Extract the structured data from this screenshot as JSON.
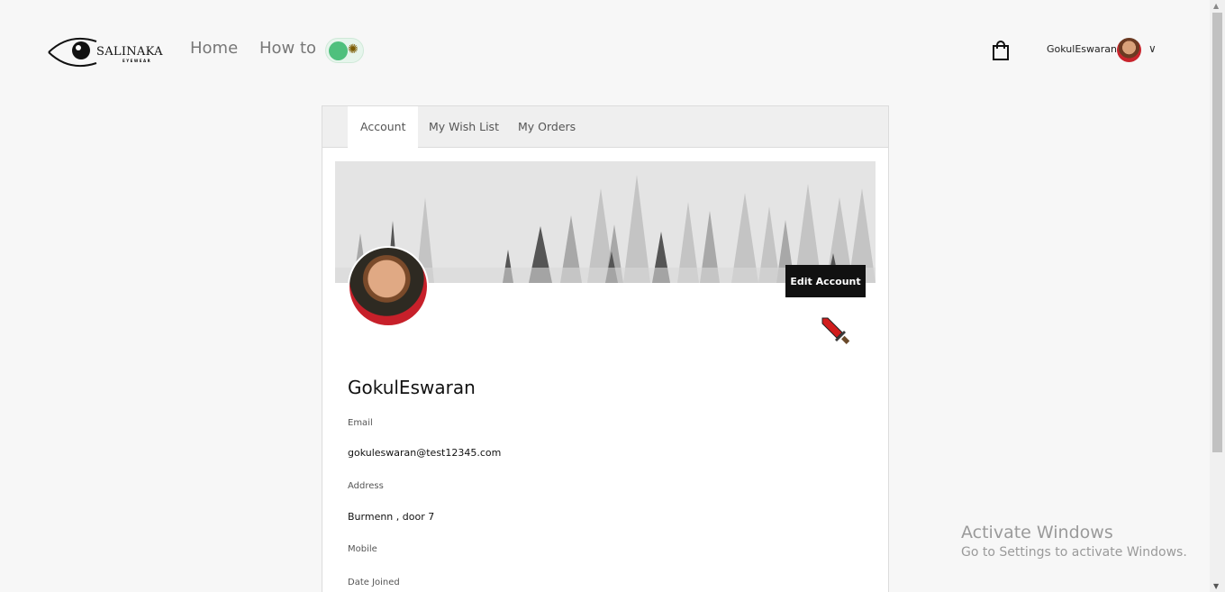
{
  "header": {
    "logo_text": "SALINAKA",
    "logo_subtext": "EYEWEAR",
    "nav": [
      {
        "label": "Home"
      },
      {
        "label": "How to"
      }
    ],
    "user_name": "GokulEswaran"
  },
  "tabs": [
    {
      "label": "Account",
      "active": true
    },
    {
      "label": "My Wish List",
      "active": false
    },
    {
      "label": "My Orders",
      "active": false
    }
  ],
  "profile": {
    "edit_button": "Edit Account",
    "name": "GokulEswaran",
    "fields": [
      {
        "label": "Email",
        "value": "gokuleswaran@test12345.com"
      },
      {
        "label": "Address",
        "value": "Burmenn , door 7"
      },
      {
        "label": "Mobile",
        "value": ""
      },
      {
        "label": "Date Joined",
        "value": ""
      }
    ]
  },
  "watermark": {
    "title": "Activate Windows",
    "subtitle": "Go to Settings to activate Windows."
  },
  "icons": {
    "logo": "eye-logo-icon",
    "theme_toggle": "sun-icon",
    "cart": "shopping-bag-icon",
    "dropdown": "chevron-down-icon",
    "cursor": "sword-icon"
  },
  "colors": {
    "toggle_knob": "#4fc07d",
    "edit_button_bg": "#111111",
    "page_bg": "#f7f7f7"
  }
}
